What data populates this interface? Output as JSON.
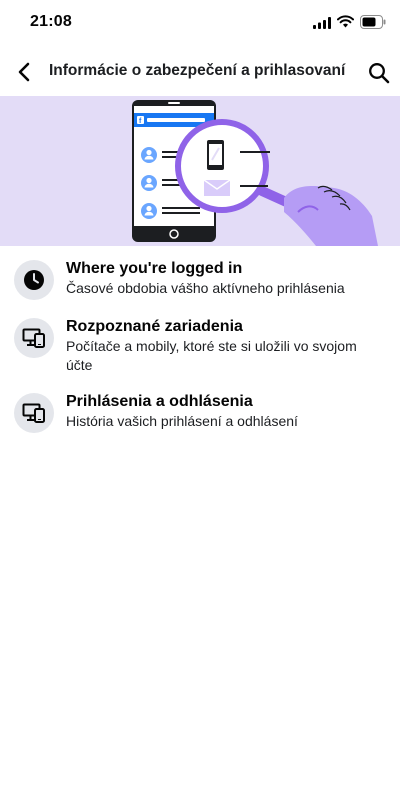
{
  "status_bar": {
    "time": "21:08"
  },
  "header": {
    "title": "Informácie o zabezpečení a prihlasovaní"
  },
  "illustration": {
    "brand_letter": "f"
  },
  "menu": {
    "items": [
      {
        "icon": "clock-icon",
        "title": "Where you're logged in",
        "description": "Časové obdobia vášho aktívneho prihlásenia"
      },
      {
        "icon": "devices-icon",
        "title": "Rozpoznané zariadenia",
        "description": "Počítače a mobily, ktoré ste si uložili vo svojom účte"
      },
      {
        "icon": "devices-icon",
        "title": "Prihlásenia a odhlásenia",
        "description": "História vašich prihlásení a odhlásení"
      }
    ]
  },
  "colors": {
    "hero_background": "#e3dcf7",
    "brand_blue": "#1877f2",
    "accent_purple": "#8f63e8",
    "icon_background": "#e4e6eb"
  }
}
